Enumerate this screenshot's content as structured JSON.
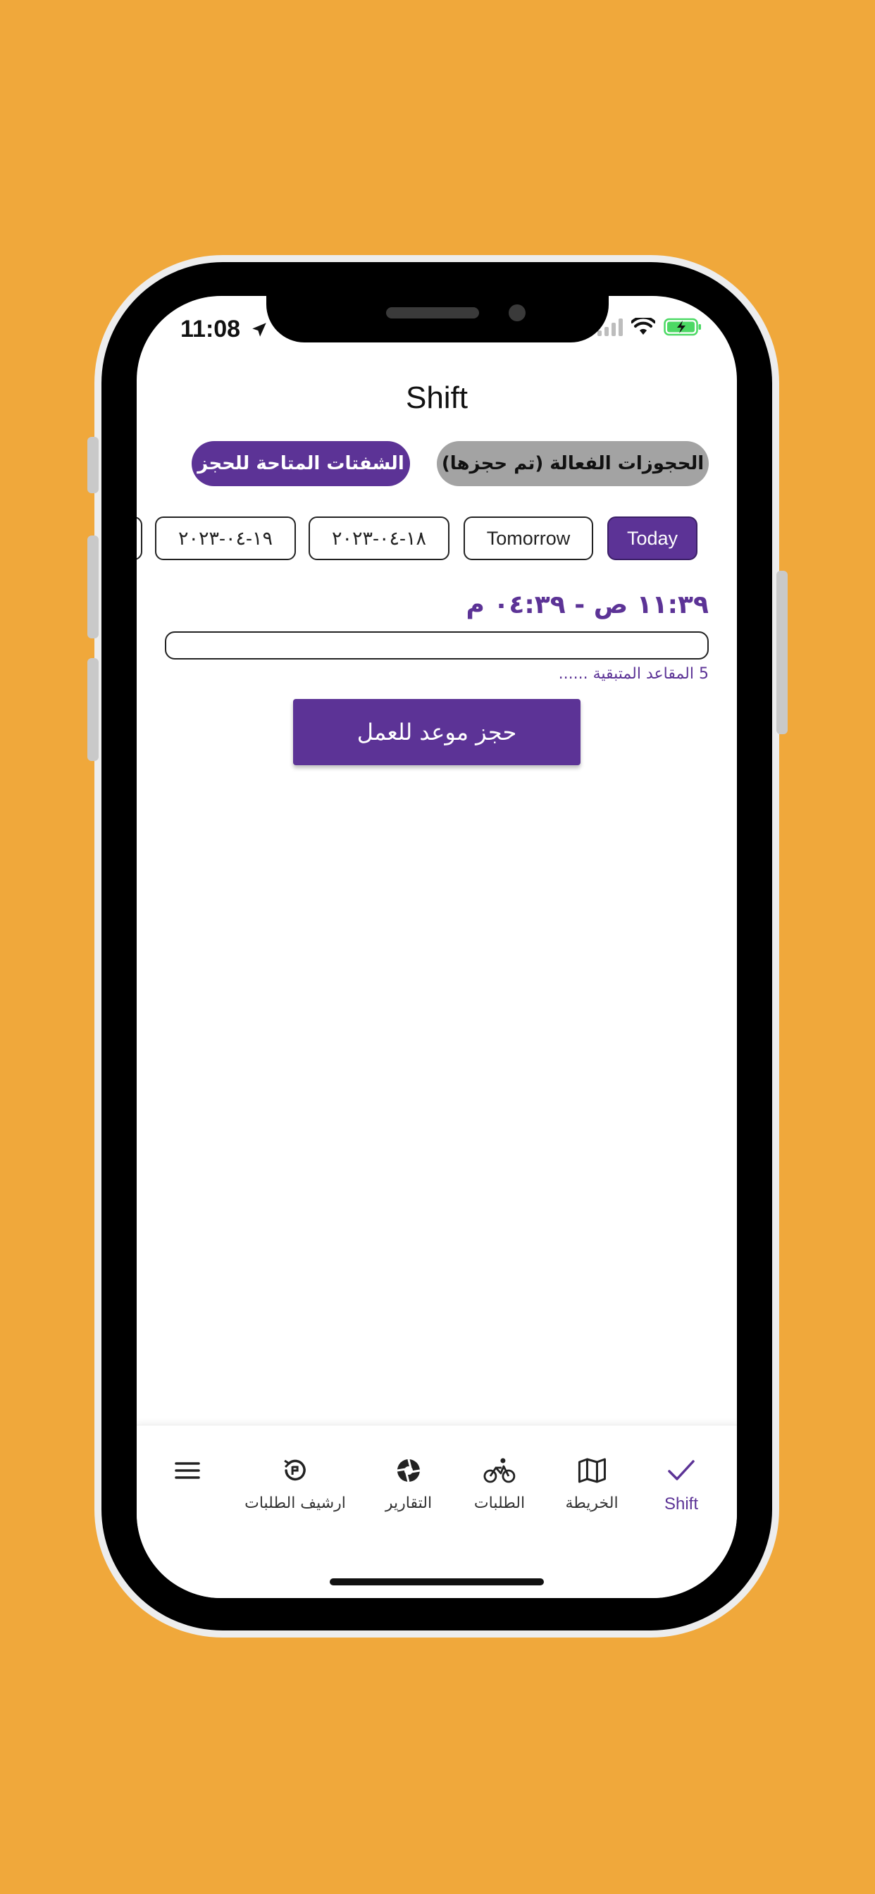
{
  "status_bar": {
    "time": "11:08"
  },
  "header": {
    "title": "Shift"
  },
  "segments": {
    "active_bookings": "الحجوزات الفعالة (تم حجزها)",
    "available_shifts": "الشفتات المتاحة للحجز"
  },
  "date_chips": [
    "Today",
    "Tomorrow",
    "١٨-٠٤-٢٠٢٣",
    "١٩-٠٤-٢٠٢٣"
  ],
  "shift": {
    "time_range": "١١:٣٩ ص - ٠٤:٣٩ م",
    "seats_remaining": "5 المقاعد المتبقية ......",
    "book_button": "حجز موعد للعمل"
  },
  "tabs": {
    "shift": "Shift",
    "map": "الخريطة",
    "orders": "الطلبات",
    "reports": "التقارير",
    "archive": "ارشيف الطلبات"
  },
  "colors": {
    "accent": "#5C3396",
    "background": "#F0A83B",
    "inactive_segment": "#A3A3A3"
  }
}
